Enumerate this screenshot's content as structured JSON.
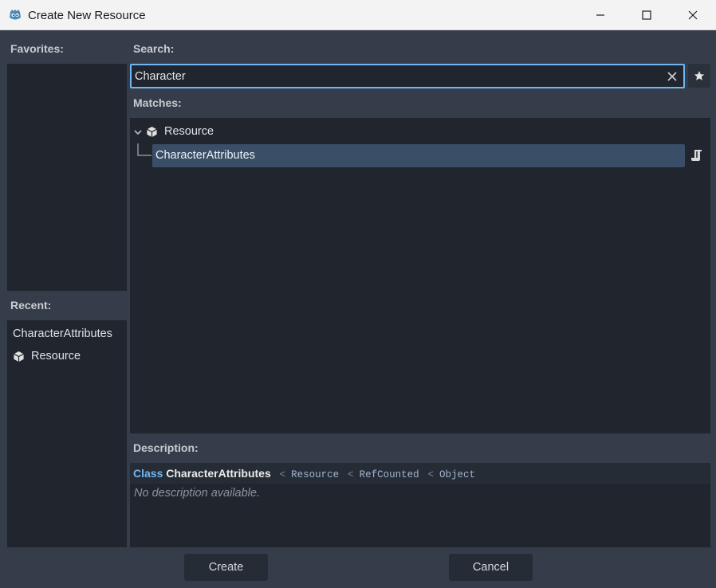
{
  "window": {
    "title": "Create New Resource"
  },
  "favorites": {
    "label": "Favorites:"
  },
  "recent": {
    "label": "Recent:",
    "items": [
      {
        "label": "CharacterAttributes",
        "icon": ""
      },
      {
        "label": "Resource",
        "icon": "cube-icon"
      }
    ]
  },
  "search": {
    "label": "Search:",
    "value": "Character"
  },
  "matches": {
    "label": "Matches:",
    "root": {
      "label": "Resource",
      "icon": "cube-icon"
    },
    "child": {
      "label": "CharacterAttributes"
    }
  },
  "description": {
    "label": "Description:",
    "keyword": "Class",
    "class_name": "CharacterAttributes",
    "inheritance": [
      "Resource",
      "RefCounted",
      "Object"
    ],
    "separator": "<",
    "body": "No description available."
  },
  "buttons": {
    "create": "Create",
    "cancel": "Cancel"
  },
  "colors": {
    "accent": "#6eb7f3",
    "panel": "#20252e",
    "background": "#363d4a",
    "selection": "#3a4e67"
  }
}
